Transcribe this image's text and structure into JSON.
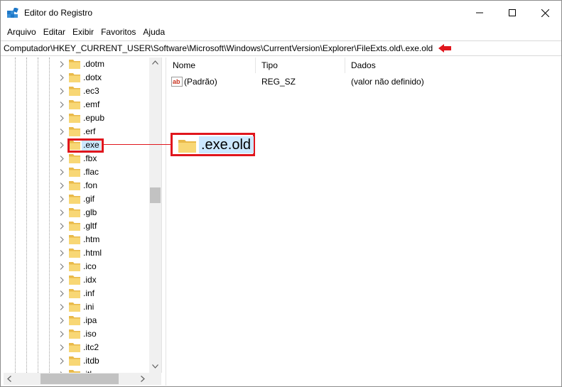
{
  "window": {
    "title": "Editor do Registro"
  },
  "menu": [
    "Arquivo",
    "Editar",
    "Exibir",
    "Favoritos",
    "Ajuda"
  ],
  "address": "Computador\\HKEY_CURRENT_USER\\Software\\Microsoft\\Windows\\CurrentVersion\\Explorer\\FileExts.old\\.exe.old",
  "tree": {
    "items": [
      ".dotm",
      ".dotx",
      ".ec3",
      ".emf",
      ".epub",
      ".erf",
      ".exe",
      ".fbx",
      ".flac",
      ".fon",
      ".gif",
      ".glb",
      ".gltf",
      ".htm",
      ".html",
      ".ico",
      ".idx",
      ".inf",
      ".ini",
      ".ipa",
      ".iso",
      ".itc2",
      ".itdb",
      ".itl"
    ],
    "selected": ".exe"
  },
  "list": {
    "headers": {
      "name": "Nome",
      "type": "Tipo",
      "data": "Dados"
    },
    "rows": [
      {
        "name": "(Padrão)",
        "type": "REG_SZ",
        "data": "(valor não definido)",
        "icon": "string-value-icon"
      }
    ]
  },
  "callout": {
    "label": ".exe.old"
  },
  "colors": {
    "highlight": "#e0161d",
    "selection": "#cce8ff",
    "folder": "#f8d775"
  }
}
